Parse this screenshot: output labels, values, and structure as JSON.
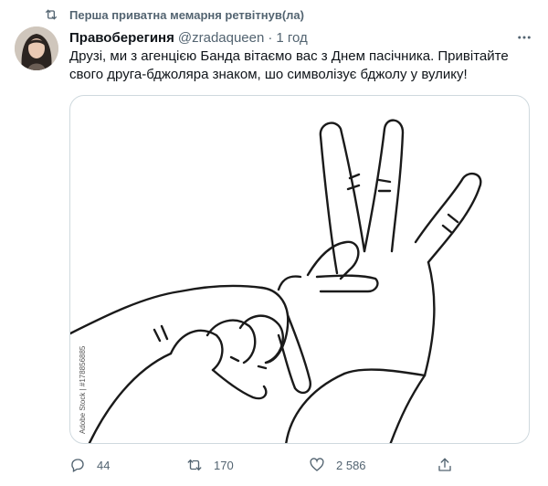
{
  "retweet_banner": "Перша приватна мемарня ретвітнув(ла)",
  "tweet": {
    "display_name": "Правоберегиня",
    "handle": "@zradaqueen",
    "separator": "·",
    "time": "1 год",
    "text": "Друзі, ми з агенцією Банда вітаємо вас з Днем пасічника. Привітайте свого друга-бджоляра знаком, шо символізує бджолу у вулику!",
    "image_watermark": "Adobe Stock | #178856885"
  },
  "actions": {
    "replies": "44",
    "retweets": "170",
    "likes": "2 586"
  },
  "icons": [
    "retweet-icon",
    "more-icon",
    "reply-icon",
    "like-icon",
    "share-icon"
  ]
}
